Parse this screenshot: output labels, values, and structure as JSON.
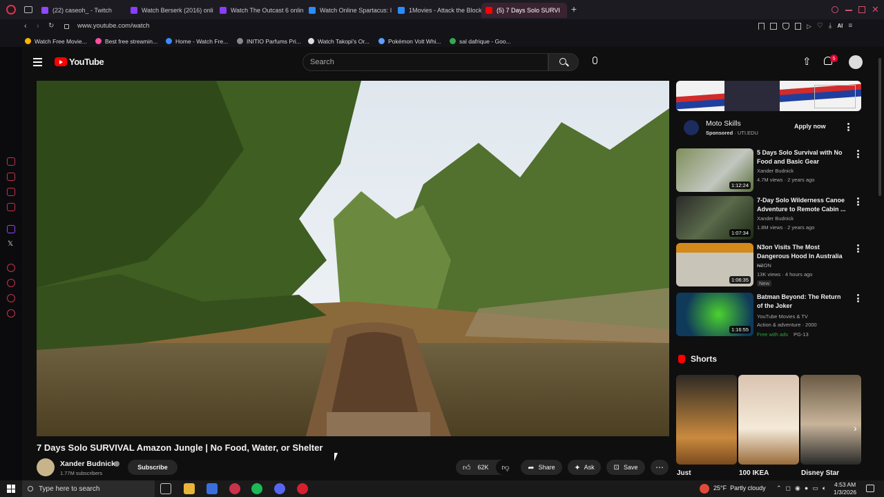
{
  "browser": {
    "tabs": [
      {
        "label": "(22) caseoh_ - Twitch",
        "color": "#9146ff"
      },
      {
        "label": "Watch Berserk (2016) onli",
        "color": "#8a3cff"
      },
      {
        "label": "Watch The Outcast 6 onlin",
        "color": "#8a3cff"
      },
      {
        "label": "Watch Online Spartacus: I",
        "color": "#2a8cff"
      },
      {
        "label": "1Movies - Attack the Block",
        "color": "#2a8cff"
      },
      {
        "label": "(5) 7 Days Solo SURVI",
        "color": "#ff0000"
      }
    ],
    "url": "www.youtube.com/watch",
    "bookmarks": [
      {
        "label": "Watch Free Movie...",
        "color": "#ffb400"
      },
      {
        "label": "Best free streamin...",
        "color": "#ff4fa0"
      },
      {
        "label": "Home - Watch Fre...",
        "color": "#3a8cff"
      },
      {
        "label": "INITIO Parfums Pri...",
        "color": "#888888"
      },
      {
        "label": "Watch Takopi's Or...",
        "color": "#dddddd"
      },
      {
        "label": "Pokémon Volt Whi...",
        "color": "#5aa0ff"
      },
      {
        "label": "sal dafrique - Goo...",
        "color": "#34a853"
      }
    ]
  },
  "youtube": {
    "logo_text": "YouTube",
    "search_placeholder": "Search",
    "notification_count": "5",
    "video": {
      "title": "7 Days Solo SURVIVAL Amazon Jungle | No Food, Water, or Shelter",
      "channel": "Xander Budnick",
      "subscribers": "1.77M subscribers",
      "subscribe_label": "Subscribe",
      "likes": "62K",
      "share_label": "Share",
      "ask_label": "Ask",
      "save_label": "Save"
    },
    "ad": {
      "title": "Moto Skills",
      "sponsored": "Sponsored",
      "domain": "UTI.EDU",
      "cta": "Apply now"
    },
    "recommendations": [
      {
        "title": "5 Days Solo Survival with No Food and Basic Gear",
        "channel": "Xander Budnick",
        "meta": "4.7M views · 2 years ago",
        "duration": "1:12:24",
        "extra": ""
      },
      {
        "title": "7-Day Solo Wilderness Canoe Adventure to Remote Cabin ...",
        "channel": "Xander Budnick",
        "meta": "1.8M views · 2 years ago",
        "duration": "1:07:34",
        "extra": ""
      },
      {
        "title": "N3on Visits The Most Dangerous Hood In Australia ...",
        "channel": "N3ON",
        "meta": "13K views · 4 hours ago",
        "duration": "1:06:35",
        "extra": "New"
      },
      {
        "title": "Batman Beyond: The Return of the Joker",
        "channel": "YouTube Movies & TV",
        "meta": "Action & adventure · 2000",
        "duration": "1:16:55",
        "extra": "Free with ads",
        "rating": "PG-13"
      }
    ],
    "shorts_label": "Shorts",
    "shorts": [
      {
        "title": "Just"
      },
      {
        "title": "100 IKEA"
      },
      {
        "title": "Disney Star"
      }
    ]
  },
  "taskbar": {
    "search_placeholder": "Type here to search",
    "weather": "25°F  Partly cloudy",
    "time": "4:53 AM",
    "date": "1/3/2026"
  }
}
